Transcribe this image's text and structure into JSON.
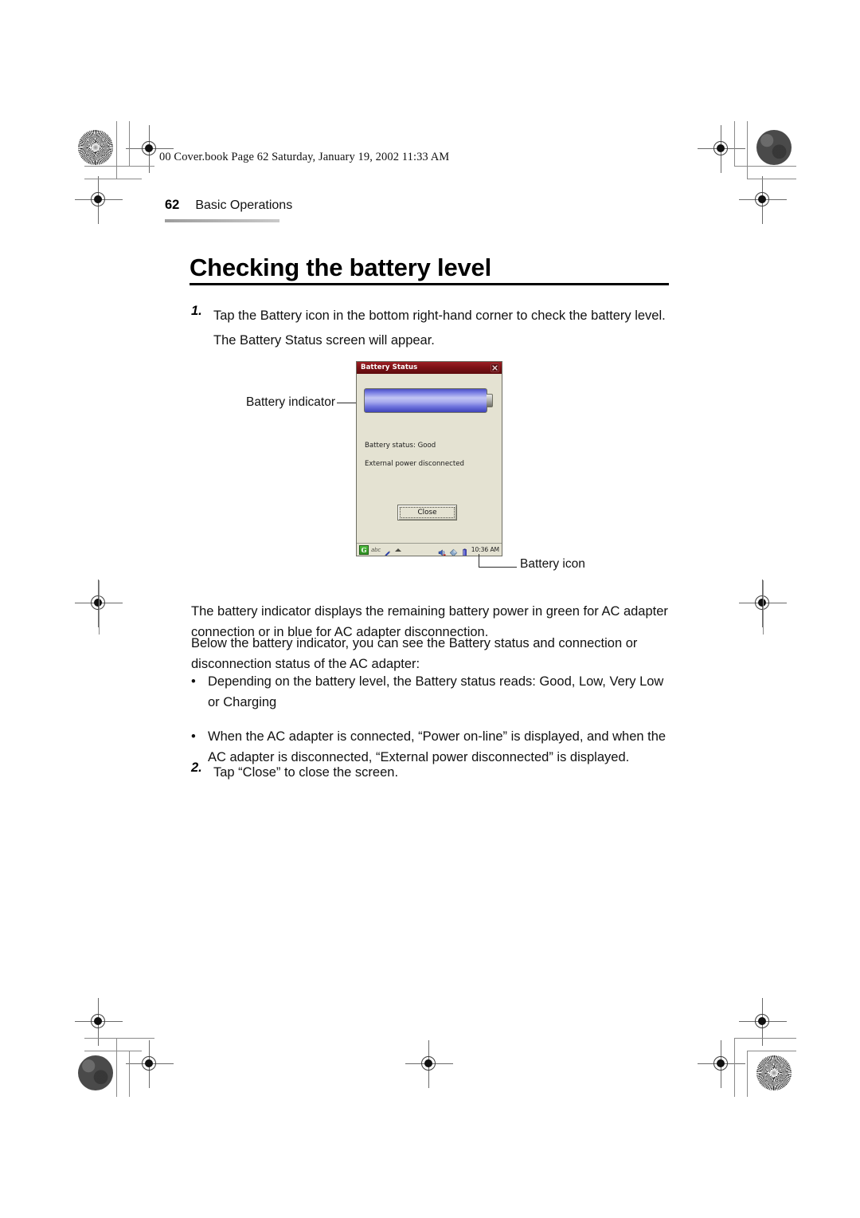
{
  "page": {
    "filestamp": "00 Cover.book  Page 62  Saturday, January 19, 2002  11:33 AM",
    "running_head": {
      "page_number": "62",
      "section": "Basic Operations"
    },
    "chapter_title": "Checking the battery level"
  },
  "steps": [
    {
      "number": "1.",
      "line1": "Tap the Battery icon in the bottom right-hand corner to check the battery level.",
      "line2": "The Battery Status screen will appear."
    },
    {
      "number": "2.",
      "line1": "Tap “Close” to close the screen."
    }
  ],
  "paragraphs": {
    "a": "The battery indicator displays the remaining battery power in green for AC adapter connection or in blue for AC adapter disconnection.",
    "b": "Below the battery indicator, you can see the Battery status and connection or disconnection status of the AC adapter:"
  },
  "bullets": [
    {
      "marker": "•",
      "text": "Depending on the battery level, the Battery status reads: Good, Low, Very Low or Charging"
    },
    {
      "marker": "•",
      "text": "When the AC adapter is connected, “Power on-line” is displayed, and when the AC adapter is disconnected, “External power disconnected” is displayed."
    }
  ],
  "callouts": {
    "battery_indicator": "Battery indicator",
    "battery_icon": "Battery icon"
  },
  "device": {
    "titlebar": {
      "title": "Battery Status",
      "close_icon": "close-icon"
    },
    "battery_indicator": {
      "fill_percent": 100,
      "fill_color": "#7b80e4",
      "meaning": "blue = AC adapter disconnected"
    },
    "status_lines": [
      "Battery status: Good",
      "External power disconnected"
    ],
    "close_button": "Close",
    "taskbar": {
      "start_label": "G",
      "input_label": "abc",
      "clock": "10:36 AM",
      "icons": [
        "start-icon",
        "pen-icon",
        "caret-up-icon",
        "speaker-icon",
        "diamond-icon",
        "battery-icon"
      ]
    }
  },
  "colors": {
    "titlebar_red": "#7d1116",
    "device_bg": "#e4e2d2",
    "battery_blue": "#7b80e4"
  }
}
